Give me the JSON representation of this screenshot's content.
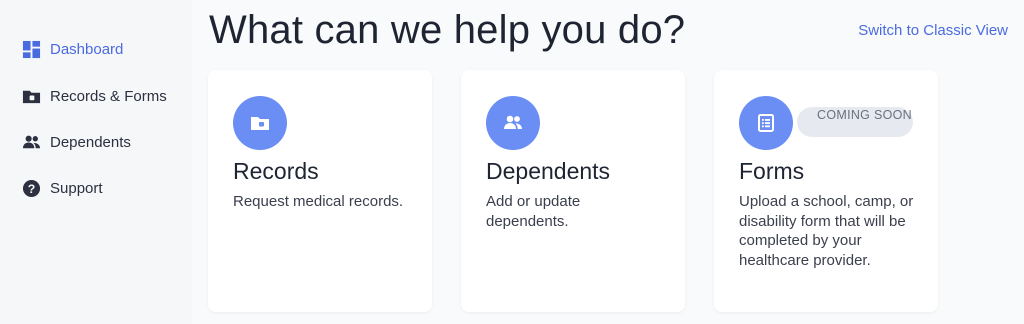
{
  "sidebar": {
    "items": [
      {
        "label": "Dashboard",
        "icon": "dashboard-icon",
        "active": true
      },
      {
        "label": "Records & Forms",
        "icon": "folder-icon",
        "active": false
      },
      {
        "label": "Dependents",
        "icon": "people-icon",
        "active": false
      },
      {
        "label": "Support",
        "icon": "help-icon",
        "active": false
      }
    ]
  },
  "header": {
    "title": "What can we help you do?",
    "classic_link": "Switch to Classic View"
  },
  "cards": [
    {
      "title": "Records",
      "description": "Request medical records.",
      "icon": "folder-icon"
    },
    {
      "title": "Dependents",
      "description": "Add or update dependents.",
      "icon": "people-icon"
    },
    {
      "title": "Forms",
      "description": "Upload a school, camp, or disability form that will be completed by your healthcare provider.",
      "icon": "form-icon",
      "badge": "COMING SOON"
    }
  ],
  "colors": {
    "accent": "#4a6be0",
    "icon_circle": "#6b8ef5",
    "badge_bg": "#e6e9f0"
  }
}
